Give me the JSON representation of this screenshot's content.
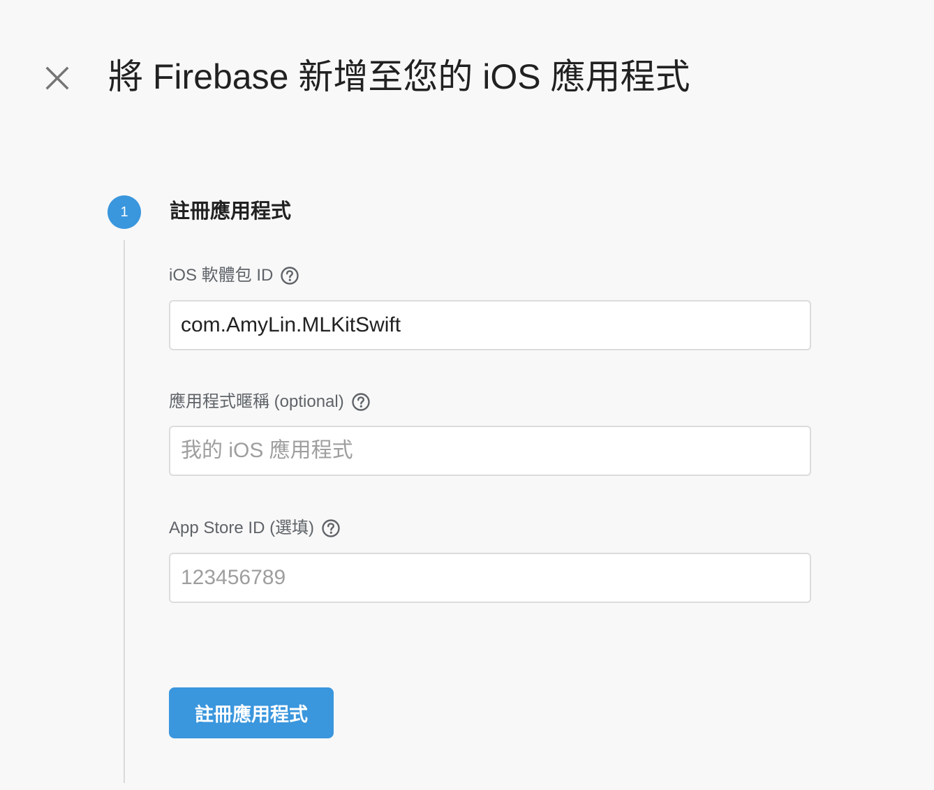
{
  "header": {
    "close_icon": "close-icon",
    "title": "將 Firebase 新增至您的 iOS 應用程式"
  },
  "step": {
    "number": "1",
    "title": "註冊應用程式"
  },
  "fields": {
    "bundle_id": {
      "label": "iOS 軟體包 ID",
      "help_icon": "help-icon",
      "value": "com.AmyLin.MLKitSwift",
      "placeholder": ""
    },
    "nickname": {
      "label": "應用程式暱稱 (optional)",
      "help_icon": "help-icon",
      "value": "",
      "placeholder": "我的 iOS 應用程式"
    },
    "app_store_id": {
      "label": "App Store ID (選填)",
      "help_icon": "help-icon",
      "value": "",
      "placeholder": "123456789"
    }
  },
  "actions": {
    "register_label": "註冊應用程式"
  },
  "colors": {
    "accent": "#3a96dd",
    "background": "#f8f8f8",
    "input_border": "#dcdcdc"
  }
}
